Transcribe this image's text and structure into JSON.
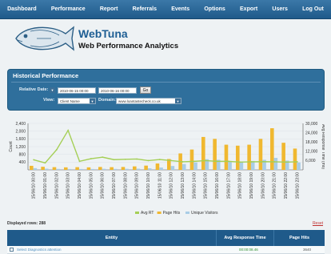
{
  "nav": [
    "Dashboard",
    "Performance",
    "Report",
    "Referrals",
    "Events",
    "Options",
    "Export",
    "Users",
    "Log Out"
  ],
  "brand": {
    "name": "WebTuna",
    "tagline": "Web Performance Analytics"
  },
  "historical": {
    "title": "Historical Performance",
    "relative_date_label": "Relative Date:",
    "from": "2010-06-15 00:00",
    "to": "2010-06-16 00:00",
    "go": "Go",
    "view_label": "View:",
    "view_value": "Client Name",
    "domain_label": "Domain:",
    "domain_value": "www.loantastecheck.co.uk"
  },
  "chart_data": {
    "type": "bar",
    "x": [
      "15/06/10 00:00",
      "15/06/10 01:00",
      "15/06/10 02:00",
      "15/06/10 03:00",
      "15/06/10 04:00",
      "15/06/10 05:00",
      "15/06/10 06:00",
      "15/06/10 07:00",
      "15/06/10 08:00",
      "15/06/10 09:00",
      "15/06/10 10:00",
      "15/06/10 11:00",
      "15/06/10 12:00",
      "15/06/10 13:00",
      "15/06/10 14:00",
      "15/06/10 15:00",
      "15/06/10 16:00",
      "15/06/10 17:00",
      "15/06/10 18:00",
      "15/06/10 19:00",
      "15/06/10 20:00",
      "15/06/10 21:00",
      "15/06/10 22:00",
      "15/06/10 23:00"
    ],
    "left_axis": {
      "label": "Count",
      "ticks": [
        "2,400",
        "2,000",
        "1,600",
        "1,200",
        "800",
        "400"
      ],
      "ylim": [
        0,
        2400
      ]
    },
    "right_axis": {
      "label": "Avg Response Time (ms)",
      "ticks": [
        "30,000",
        "24,000",
        "18,000",
        "12,000",
        "6,000"
      ],
      "ylim": [
        0,
        30000
      ]
    },
    "series": [
      {
        "name": "Avg RT",
        "type": "line",
        "axis": "right",
        "color": "#a5cf56",
        "values": [
          6500,
          4500,
          13000,
          25500,
          5500,
          7200,
          8200,
          6600,
          6800,
          7000,
          6000,
          6700,
          6000,
          5200,
          5500,
          6000,
          5500,
          5500,
          5000,
          5200,
          5300,
          5200,
          5000,
          5200
        ]
      },
      {
        "name": "Page Hits",
        "type": "bar",
        "axis": "left",
        "color": "#f0b830",
        "values": [
          210,
          160,
          140,
          130,
          140,
          130,
          150,
          140,
          150,
          180,
          220,
          330,
          560,
          850,
          1050,
          1700,
          1600,
          1300,
          1250,
          1300,
          1600,
          2150,
          1400,
          1100
        ]
      },
      {
        "name": "Unique Visitors",
        "type": "bar",
        "axis": "left",
        "color": "#a9cde6",
        "values": [
          90,
          60,
          50,
          45,
          45,
          45,
          55,
          50,
          55,
          60,
          80,
          120,
          200,
          300,
          380,
          550,
          520,
          450,
          430,
          460,
          520,
          620,
          480,
          380
        ]
      }
    ]
  },
  "rows": {
    "label": "Displayed rows: 288",
    "reset": "Reset"
  },
  "table": {
    "columns": [
      "Entity",
      "Avg Response Time",
      "Page Hits"
    ],
    "row": {
      "entity": "Select Diagnostics attention",
      "avg_rt": "00:00:08.46",
      "hits": "3640"
    }
  }
}
